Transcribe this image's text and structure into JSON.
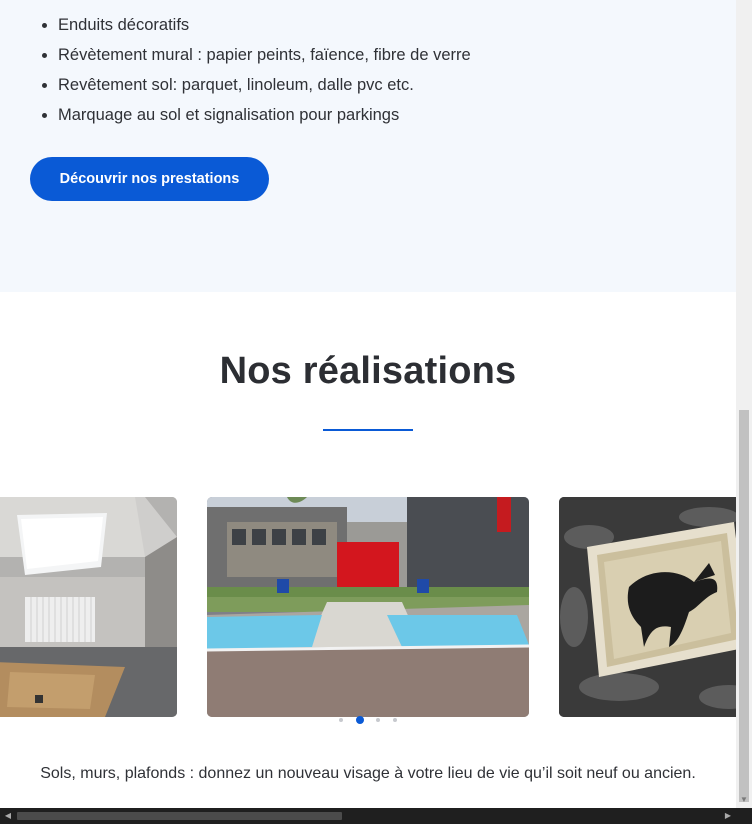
{
  "services": {
    "items": [
      "Enduits décoratifs",
      "Révètement mural : papier peints, faïence, fibre de verre",
      "Revêtement sol: parquet, linoleum, dalle pvc etc.",
      "Marquage au sol et signalisation pour parkings"
    ],
    "cta_label": "Découvrir nos prestations"
  },
  "realisations": {
    "title": "Nos réalisations",
    "accent_color": "#0a5ad6",
    "slides": [
      {
        "subject": "attic room with skylight and radiator"
      },
      {
        "subject": "parking spaces with blue accessible markings in front of building"
      },
      {
        "subject": "framed horse painting on marbled wall"
      }
    ],
    "active_dot": 2,
    "dot_count": 4,
    "description": "Sols, murs, plafonds : donnez un nouveau visage à votre lieu de vie qu’il soit neuf ou ancien."
  }
}
